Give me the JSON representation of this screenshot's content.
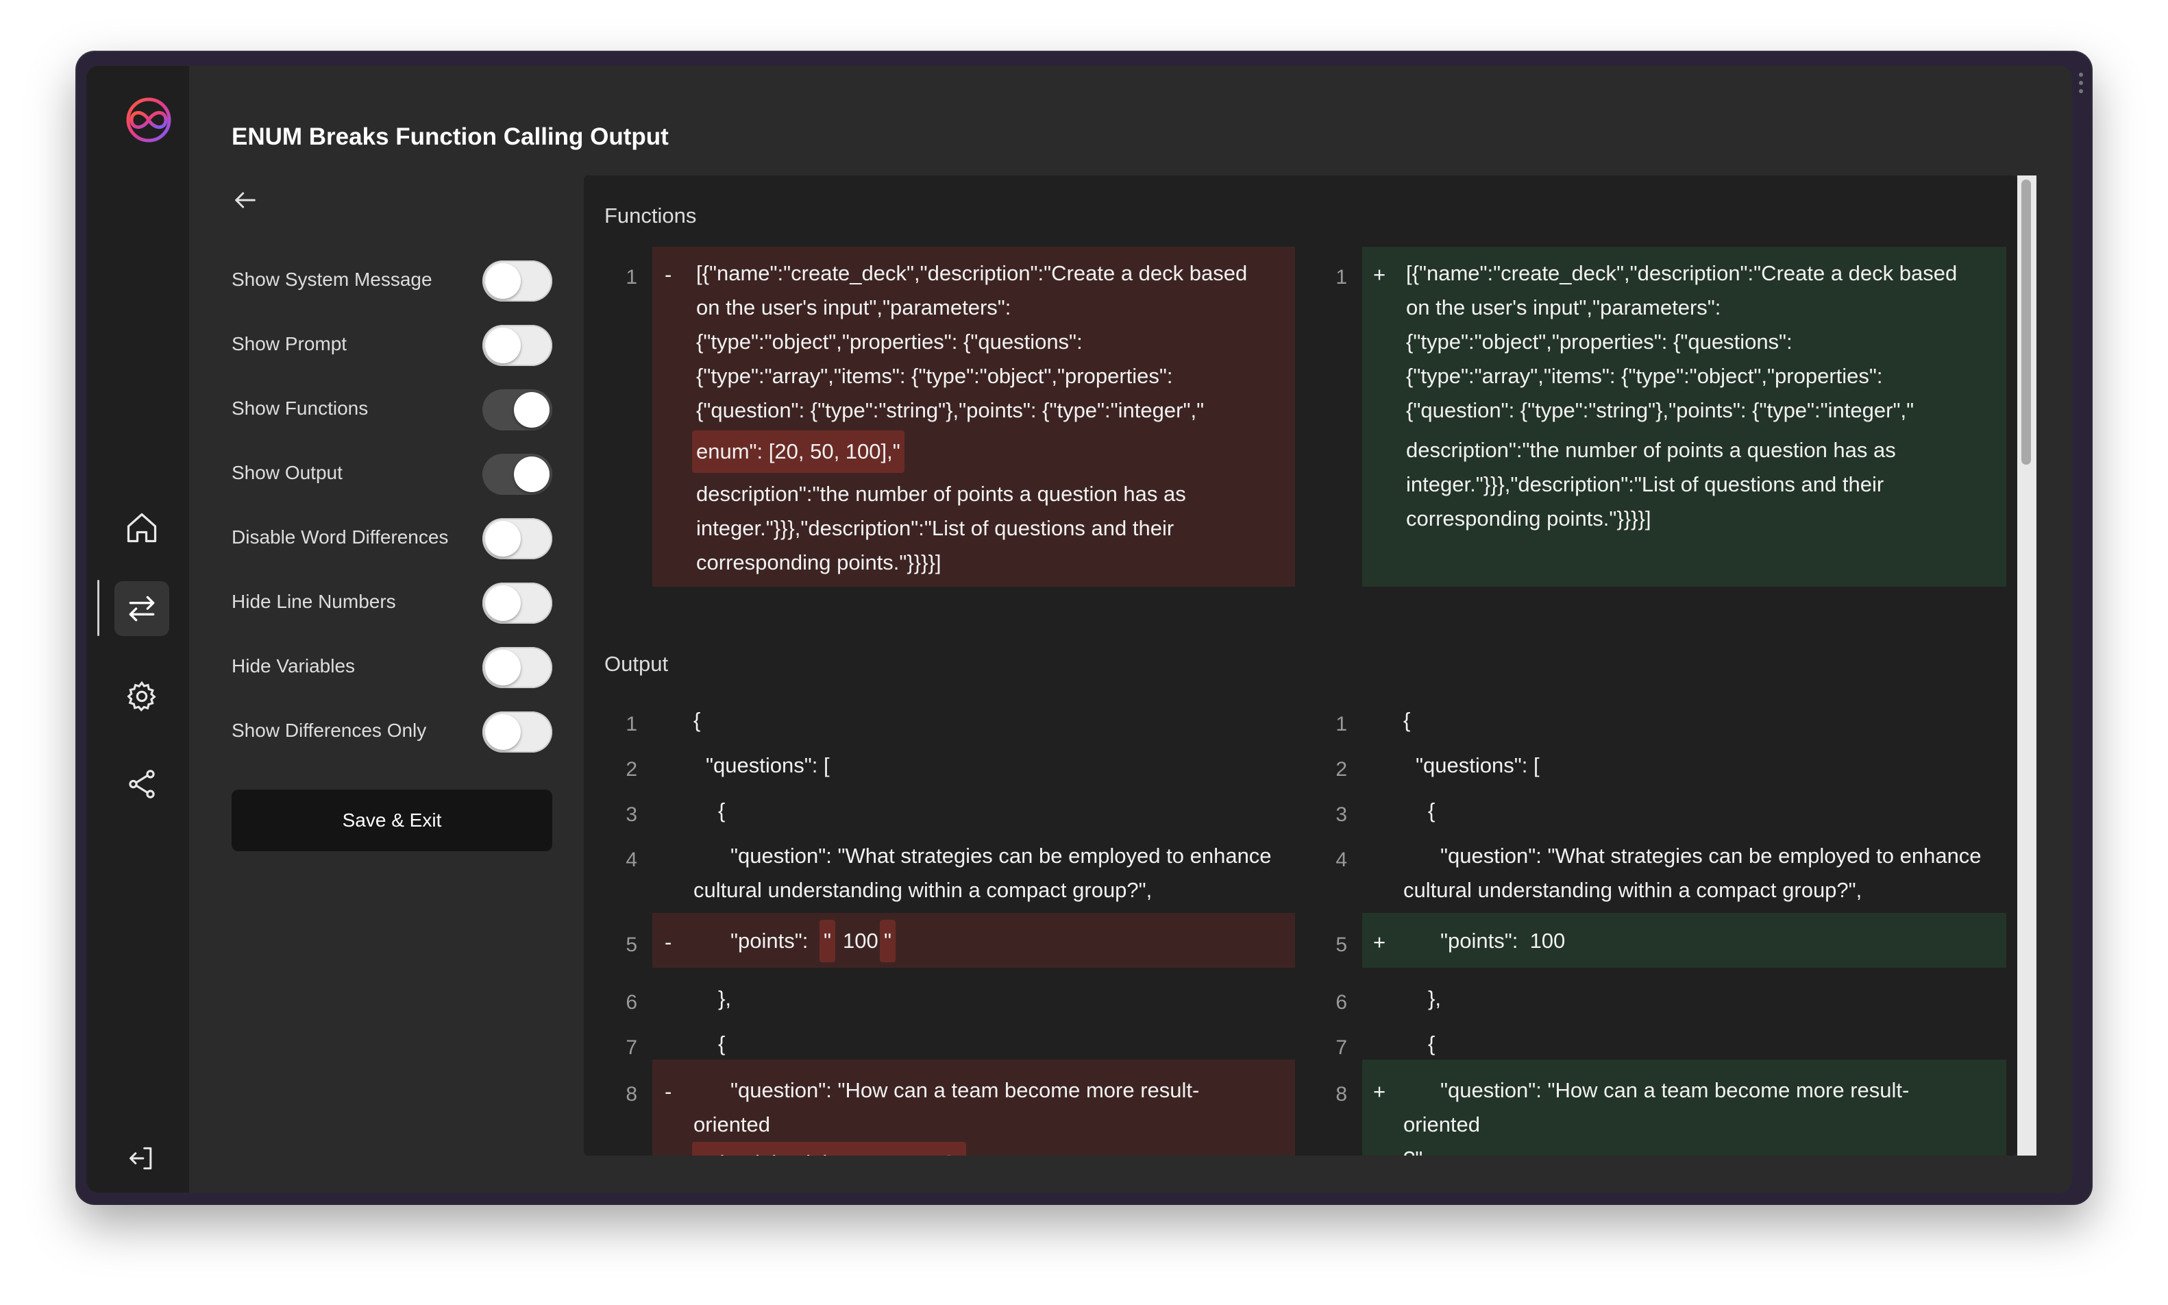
{
  "app": {
    "title": "ENUM Breaks Function Calling Output",
    "save_label": "Save & Exit"
  },
  "settings": [
    {
      "label": "Show System Message",
      "on": false
    },
    {
      "label": "Show Prompt",
      "on": false
    },
    {
      "label": "Show Functions",
      "on": true
    },
    {
      "label": "Show Output",
      "on": true
    },
    {
      "label": "Disable Word Differences",
      "on": false
    },
    {
      "label": "Hide Line Numbers",
      "on": false
    },
    {
      "label": "Hide Variables",
      "on": false
    },
    {
      "label": "Show Differences Only",
      "on": false
    }
  ],
  "functions": {
    "title": "Functions",
    "left": {
      "line_number": "1",
      "sign": "-",
      "lines": [
        "[{\"name\":\"create_deck\",\"description\":\"Create a deck based",
        "on the user's input\",\"parameters\":",
        "{\"type\":\"object\",\"properties\": {\"questions\":",
        "{\"type\":\"array\",\"items\": {\"type\":\"object\",\"properties\":",
        "{\"question\": {\"type\":\"string\"},\"points\": {\"type\":\"integer\",\""
      ],
      "removed_highlight": "enum\": [20, 50, 100],\"",
      "lines_after": [
        "description\":\"the number of points a question has as",
        "integer.\"}}},\"description\":\"List of questions and their",
        "corresponding points.\"}}}}]"
      ]
    },
    "right": {
      "line_number": "1",
      "sign": "+",
      "lines": [
        "[{\"name\":\"create_deck\",\"description\":\"Create a deck based",
        "on the user's input\",\"parameters\":",
        "{\"type\":\"object\",\"properties\": {\"questions\":",
        "{\"type\":\"array\",\"items\": {\"type\":\"object\",\"properties\":",
        "{\"question\": {\"type\":\"string\"},\"points\": {\"type\":\"integer\",\""
      ],
      "lines_after": [
        "description\":\"the number of points a question has as",
        "integer.\"}}},\"description\":\"List of questions and their",
        "corresponding points.\"}}}}]"
      ]
    }
  },
  "output": {
    "title": "Output",
    "left": {
      "l1": {
        "n": "1",
        "text": "{"
      },
      "l2": {
        "n": "2",
        "text": "\"questions\": ["
      },
      "l3": {
        "n": "3",
        "text": "{"
      },
      "l4": {
        "n": "4",
        "text": "\"question\": \"What strategies can be employed to enhance",
        "text2": "cultural understanding within a compact group?\","
      },
      "l5": {
        "n": "5",
        "sign": "-",
        "text": "\"points\": ",
        "q1": "\"",
        "value": "100",
        "q2": "\""
      },
      "l6": {
        "n": "6",
        "text": "},"
      },
      "l7": {
        "n": "7",
        "text": "{"
      },
      "l8": {
        "n": "8",
        "sign": "-",
        "text": "\"question\": \"How can a team become more result-",
        "text2": "oriented",
        "text3": "... by doing it in a compact?\""
      }
    },
    "right": {
      "l1": {
        "n": "1",
        "text": "{"
      },
      "l2": {
        "n": "2",
        "text": "\"questions\": ["
      },
      "l3": {
        "n": "3",
        "text": "{"
      },
      "l4": {
        "n": "4",
        "text": "\"question\": \"What strategies can be employed to enhance",
        "text2": "cultural understanding within a compact group?\","
      },
      "l5": {
        "n": "5",
        "sign": "+",
        "text": "\"points\":  100"
      },
      "l6": {
        "n": "6",
        "text": "},"
      },
      "l7": {
        "n": "7",
        "text": "{"
      },
      "l8": {
        "n": "8",
        "sign": "+",
        "text": "\"question\": \"How can a team become more result-",
        "text2": "oriented",
        "text3": "?\","
      }
    }
  }
}
